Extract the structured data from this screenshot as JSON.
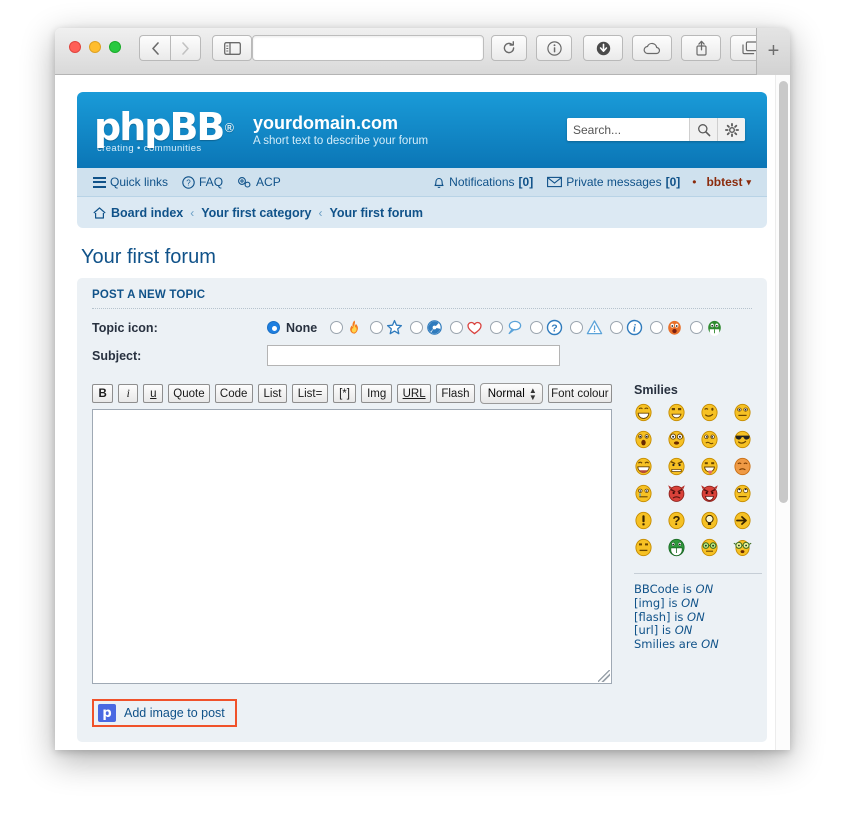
{
  "browser": {
    "url_value": "",
    "buttons": {
      "back": "back-icon",
      "forward": "forward-icon",
      "sidebar": "sidebar-icon",
      "reload": "reload-icon",
      "info": "info-icon",
      "download": "download-icon",
      "cloud": "icloud-icon",
      "share": "share-icon",
      "tabs": "show-tabs-icon",
      "newtab": "+"
    }
  },
  "site": {
    "logo_text": "phpBB",
    "logo_registered": "®",
    "logo_tagline": "creating • communities",
    "title": "yourdomain.com",
    "description": "A short text to describe your forum",
    "search": {
      "placeholder": "Search...",
      "value": "",
      "search_icon": "magnifier-icon",
      "settings_icon": "gear-icon"
    }
  },
  "navbar": {
    "left": [
      {
        "label": "Quick links",
        "icon": "hamburger-icon"
      },
      {
        "label": "FAQ",
        "icon": "question-circle-icon"
      },
      {
        "label": "ACP",
        "icon": "gears-icon"
      }
    ],
    "right": [
      {
        "label": "Notifications",
        "count": "[0]",
        "icon": "bell-icon"
      },
      {
        "label": "Private messages",
        "count": "[0]",
        "icon": "envelope-icon"
      }
    ],
    "separator": "•",
    "user": "bbtest",
    "user_caret": "▾"
  },
  "breadcrumb": {
    "separator": "‹",
    "items": [
      {
        "label": "Board index",
        "icon": "home-icon"
      },
      {
        "label": "Your first category",
        "icon": ""
      },
      {
        "label": "Your first forum",
        "icon": ""
      }
    ]
  },
  "page": {
    "title": "Your first forum",
    "panel_heading": "POST A NEW TOPIC"
  },
  "form": {
    "topic_icon_label": "Topic icon:",
    "topic_icon_none": "None",
    "topic_icons": [
      {
        "name": "none",
        "selected": true
      },
      {
        "name": "flame-icon",
        "selected": false
      },
      {
        "name": "star-icon",
        "selected": false
      },
      {
        "name": "radioactive-icon",
        "selected": false
      },
      {
        "name": "heart-icon",
        "selected": false
      },
      {
        "name": "speech-bubble-icon",
        "selected": false
      },
      {
        "name": "question-icon",
        "selected": false
      },
      {
        "name": "warning-icon",
        "selected": false
      },
      {
        "name": "info-icon",
        "selected": false
      },
      {
        "name": "orange-face-icon",
        "selected": false
      },
      {
        "name": "green-face-icon",
        "selected": false
      }
    ],
    "subject_label": "Subject:",
    "subject_value": "",
    "message_value": ""
  },
  "bbcode_toolbar": {
    "buttons": [
      {
        "label": "B",
        "name": "bold-button"
      },
      {
        "label": "i",
        "name": "italic-button"
      },
      {
        "label": "u",
        "name": "underline-button"
      },
      {
        "label": "Quote",
        "name": "quote-button"
      },
      {
        "label": "Code",
        "name": "code-button"
      },
      {
        "label": "List",
        "name": "list-button"
      },
      {
        "label": "List=",
        "name": "ordered-list-button"
      },
      {
        "label": "[*]",
        "name": "list-item-button"
      },
      {
        "label": "Img",
        "name": "image-button"
      },
      {
        "label": "URL",
        "name": "url-button"
      },
      {
        "label": "Flash",
        "name": "flash-button"
      }
    ],
    "font_size_selected": "Normal",
    "font_colour_label": "Font colour"
  },
  "smilies": {
    "title": "Smilies",
    "items": [
      "grin-smiley",
      "smile-smiley",
      "wink-smiley",
      "neutral-smiley",
      "surprised-smiley",
      "eek-smiley",
      "confused-smiley",
      "cool-smiley",
      "laugh-smiley",
      "angry-smiley",
      "razz-smiley",
      "redface-smiley",
      "cry-smiley",
      "evil-smiley",
      "twisted-smiley",
      "rolleyes-smiley",
      "exclaim-smiley",
      "question-smiley",
      "idea-smiley",
      "arrow-smiley",
      "neutral2-smiley",
      "mrgreen-smiley",
      "geek-smiley",
      "ugeek-smiley"
    ]
  },
  "bbcode_status": [
    {
      "prefix": "BBCode is ",
      "state": "ON"
    },
    {
      "prefix": "[img] is ",
      "state": "ON"
    },
    {
      "prefix": "[flash] is ",
      "state": "ON"
    },
    {
      "prefix": "[url] is ",
      "state": "ON"
    },
    {
      "prefix": "Smilies are ",
      "state": "ON"
    }
  ],
  "add_image": {
    "label": "Add image to post",
    "icon_letter": "p",
    "highlight_color": "#f0522a"
  }
}
